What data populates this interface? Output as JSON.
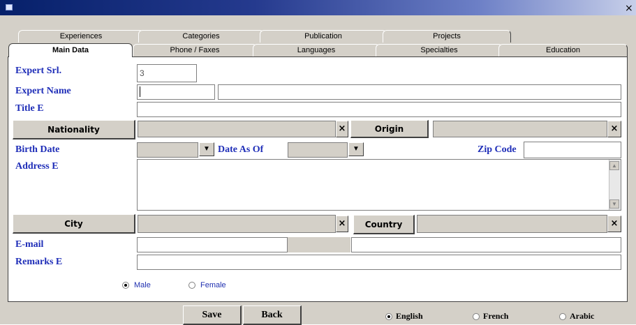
{
  "window": {
    "title": "",
    "close": "×"
  },
  "tabs_row1": [
    "Experiences",
    "Categories",
    "Publication",
    "Projects"
  ],
  "tabs_row2": [
    "Main Data",
    "Phone / Faxes",
    "Languages",
    "Specialties",
    "Education"
  ],
  "active_tab": "Main Data",
  "form": {
    "expert_srl_label": "Expert Srl.",
    "expert_srl_value": "3",
    "expert_name_label": "Expert Name",
    "expert_name_first": "",
    "expert_name_last": "",
    "title_label": "Title E",
    "title_value": "",
    "nationality_button": "Nationality",
    "nationality_value": "",
    "clear_x": "×",
    "origin_button": "Origin",
    "origin_value": "",
    "birth_date_label": "Birth Date",
    "birth_date_value": "",
    "date_as_of_label": "Date As Of",
    "date_as_of_value": "",
    "zip_code_label": "Zip Code",
    "zip_code_value": "",
    "address_label": "Address E",
    "address_value": "",
    "city_button": "City",
    "city_value": "",
    "country_button": "Country",
    "country_value": "",
    "email_label": "E-mail",
    "email_value": "",
    "email_value2": "",
    "remarks_label": "Remarks E",
    "remarks_value": "",
    "gender_options": [
      "Male",
      "Female"
    ],
    "gender_selected": "Male"
  },
  "footer": {
    "save": "Save",
    "back": "Back",
    "languages": [
      "English",
      "French",
      "Arabic"
    ],
    "language_selected": "English"
  },
  "icons": {
    "dropdown": "▼",
    "scroll_up": "▲",
    "scroll_down": "▼"
  }
}
